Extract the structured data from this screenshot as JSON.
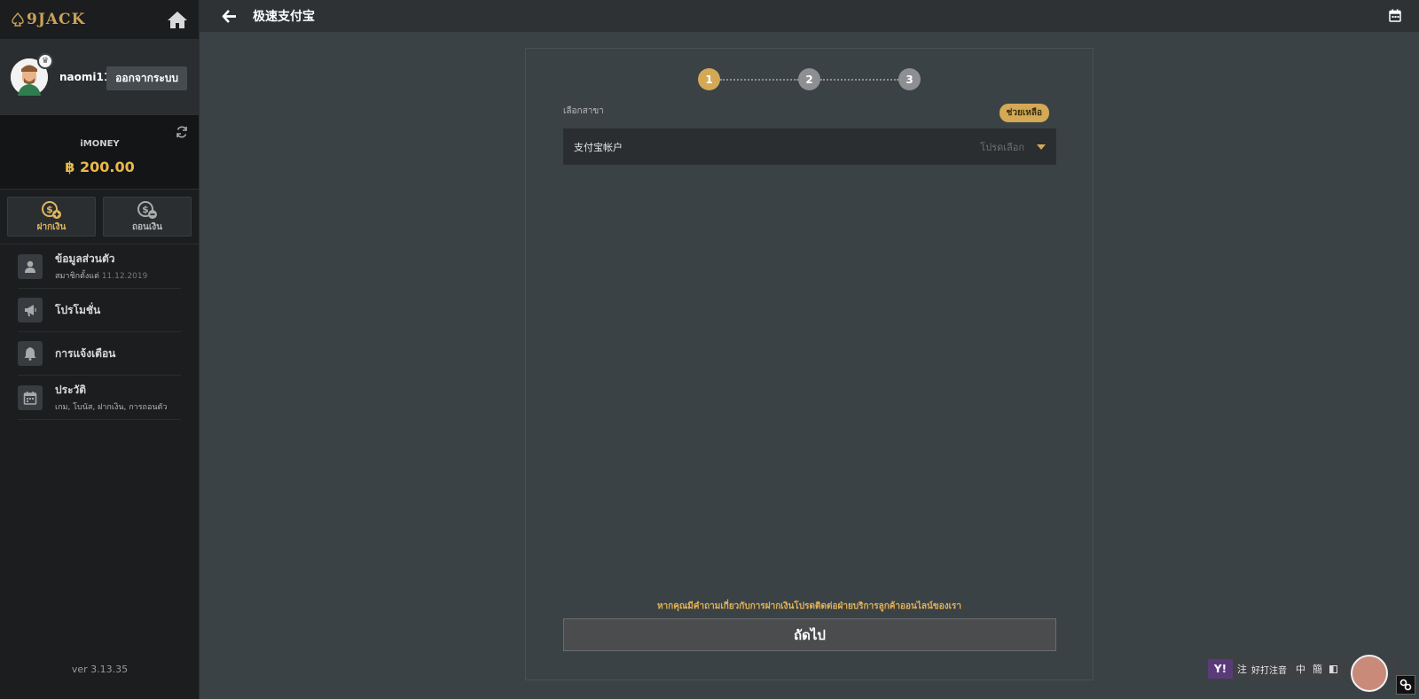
{
  "brand": {
    "logo_text": "9JACK"
  },
  "user": {
    "username": "naomi11",
    "logout_label": "ออกจากระบบ"
  },
  "wallet": {
    "label": "iMONEY",
    "amount": "฿ 200.00"
  },
  "actions": {
    "deposit_label": "ฝากเงิน",
    "withdraw_label": "ถอนเงิน"
  },
  "menu": {
    "profile": {
      "title": "ข้อมูลส่วนตัว",
      "sub_prefix": "สมาชิกตั้งแต่",
      "sub_date": "11.12.2019"
    },
    "promotion": {
      "title": "โปรโมชั่น"
    },
    "notification": {
      "title": "การแจ้งเตือน"
    },
    "history": {
      "title": "ประวัติ",
      "sub": "เกม, โบนัส, ฝากเงิน, การถอนตัว"
    }
  },
  "version": "ver 3.13.35",
  "header": {
    "title": "极速支付宝"
  },
  "steps": [
    "1",
    "2",
    "3"
  ],
  "form": {
    "branch_label": "เลือกสาขา",
    "help_label": "ช่วยเหลือ",
    "account_label": "支付宝帐户",
    "account_placeholder": "โปรดเลือก",
    "notice": "หากคุณมีคำถามเกี่ยวกับการฝากเงินโปรดติดต่อฝ่ายบริการลูกค้าออนไลน์ของเรา",
    "next_label": "ถัดไป"
  },
  "ime": {
    "y": "Y!",
    "zhu": "注",
    "mode": "好打注音",
    "zh": "中",
    "simp": "簡"
  },
  "colors": {
    "accent": "#d4a956",
    "sidebar_bg": "#1b1d1f",
    "main_bg": "#3b4245"
  }
}
